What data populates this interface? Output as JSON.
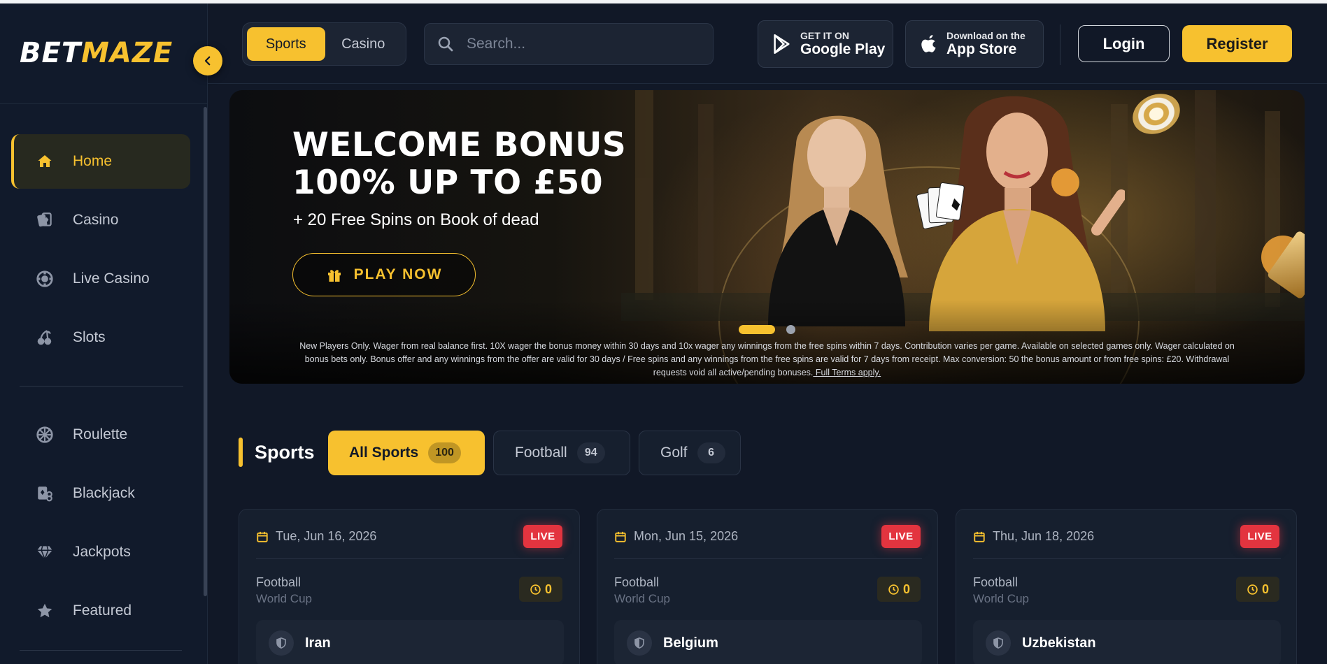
{
  "brand": {
    "logo_part1": "BET",
    "logo_part2": "MAZE",
    "accent": "#f7c12f"
  },
  "header": {
    "toggle": {
      "sports": "Sports",
      "casino": "Casino"
    },
    "search_placeholder": "Search...",
    "google_play": {
      "small": "GET IT ON",
      "big": "Google Play"
    },
    "app_store": {
      "small": "Download on the",
      "big": "App Store"
    },
    "login": "Login",
    "register": "Register"
  },
  "sidebar": {
    "items": [
      {
        "label": "Home",
        "icon": "home-icon",
        "active": true
      },
      {
        "label": "Casino",
        "icon": "cards-icon"
      },
      {
        "label": "Live Casino",
        "icon": "chip-icon"
      },
      {
        "label": "Slots",
        "icon": "cherries-icon"
      },
      {
        "label": "Roulette",
        "icon": "roulette-icon"
      },
      {
        "label": "Blackjack",
        "icon": "blackjack-icon"
      },
      {
        "label": "Jackpots",
        "icon": "diamond-icon"
      },
      {
        "label": "Featured",
        "icon": "star-icon"
      }
    ]
  },
  "banner": {
    "title_line1": "WELCOME BONUS",
    "title_line2": "100% UP TO £50",
    "subtitle": "+ 20 Free Spins on Book of dead",
    "cta": "PLAY NOW",
    "terms": "New Players Only. Wager from real balance first. 10X wager the bonus money within 30 days and 10x wager any winnings from the free spins within 7 days. Contribution varies per game. Available on selected games only. Wager calculated on bonus bets only. Bonus offer and any winnings from the offer are valid for 30 days / Free spins and any winnings from the free spins are valid for 7 days from receipt. Max conversion: 50 the bonus amount or from free spins: £20. Withdrawal requests void all active/pending bonuses.",
    "terms_link": " Full Terms apply.",
    "slides": 2,
    "active_slide": 1
  },
  "sports": {
    "title": "Sports",
    "filters": [
      {
        "label": "All Sports",
        "count": "100",
        "active": true
      },
      {
        "label": "Football",
        "count": "94"
      },
      {
        "label": "Golf",
        "count": "6"
      }
    ]
  },
  "matches": [
    {
      "date": "Tue, Jun 16, 2026",
      "status": "LIVE",
      "sport": "Football",
      "league": "World Cup",
      "timer": "0",
      "team": "Iran"
    },
    {
      "date": "Mon, Jun 15, 2026",
      "status": "LIVE",
      "sport": "Football",
      "league": "World Cup",
      "timer": "0",
      "team": "Belgium"
    },
    {
      "date": "Thu, Jun 18, 2026",
      "status": "LIVE",
      "sport": "Football",
      "league": "World Cup",
      "timer": "0",
      "team": "Uzbekistan"
    }
  ]
}
